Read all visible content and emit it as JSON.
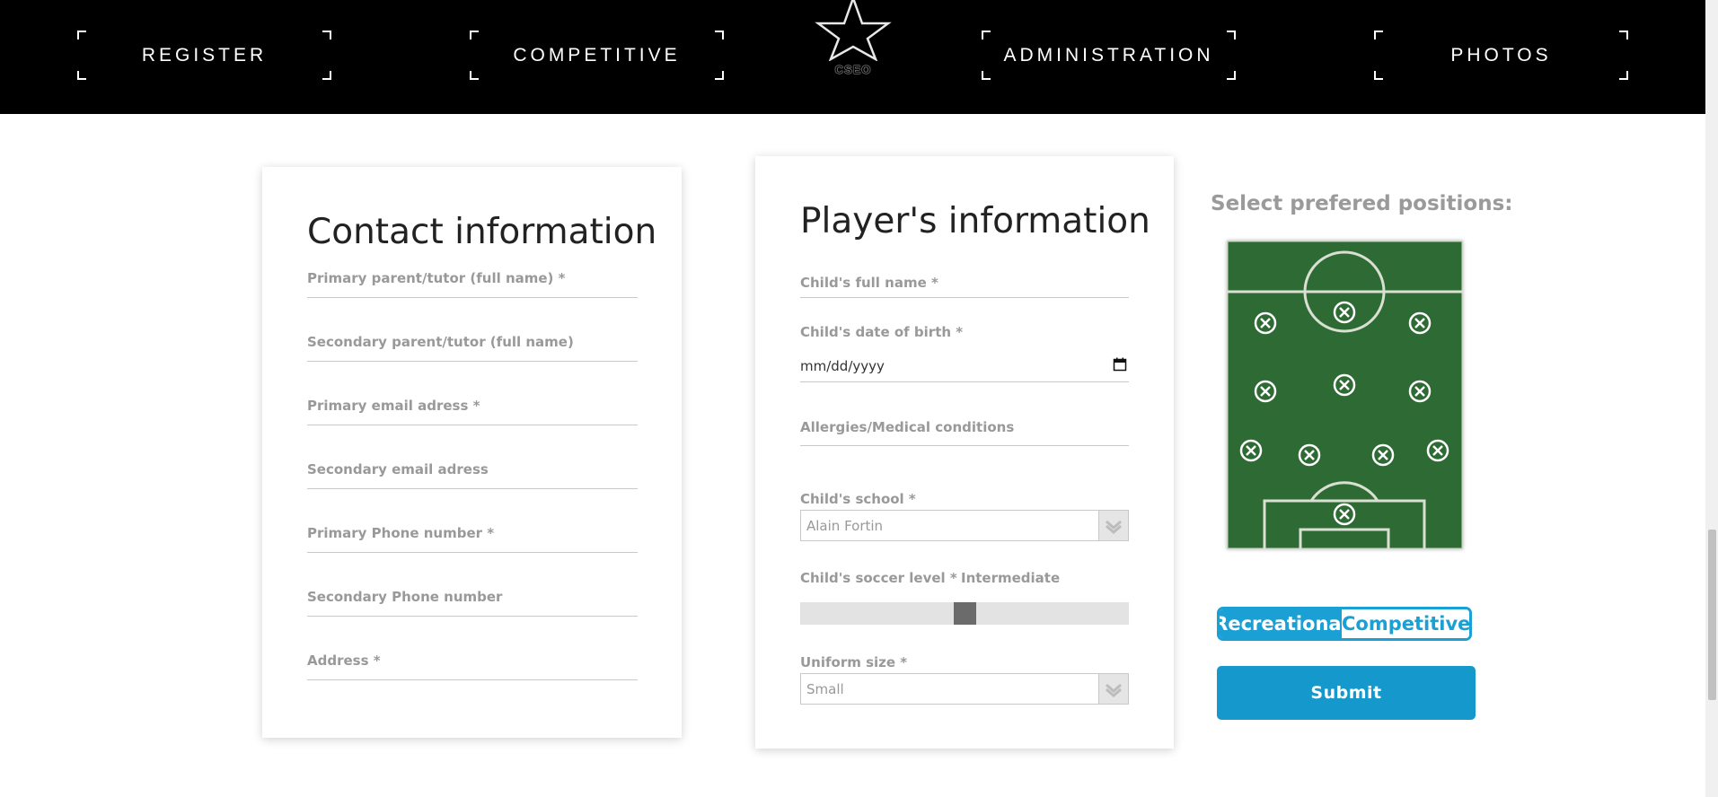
{
  "nav": {
    "items": [
      {
        "label": "REGISTER"
      },
      {
        "label": "COMPETITIVE"
      },
      {
        "label": "ADMINISTRATION"
      },
      {
        "label": "PHOTOS"
      }
    ],
    "logo_text": "CSEO",
    "logo_icon": "star-icon"
  },
  "contact": {
    "title": "Contact information",
    "fields": [
      {
        "label": "Primary parent/tutor (full name) *"
      },
      {
        "label": "Secondary parent/tutor (full name)"
      },
      {
        "label": "Primary email adress *"
      },
      {
        "label": "Secondary email adress"
      },
      {
        "label": "Primary Phone number *"
      },
      {
        "label": "Secondary Phone number"
      },
      {
        "label": "Address *"
      }
    ]
  },
  "player": {
    "title": "Player's information",
    "name_label": "Child's full name *",
    "dob_label": "Child's date of birth *",
    "dob_placeholder": "mm/dd/yyyy",
    "allergies_label": "Allergies/Medical conditions",
    "school_label": "Child's school *",
    "school_value": "Alain Fortin",
    "level_label": "Child's soccer level *",
    "level_value": "Intermediate",
    "level_fraction": 0.5,
    "uniform_label": "Uniform size *",
    "uniform_value": "Small"
  },
  "positions": {
    "title": "Select prefered positions:",
    "marker_icon": "circle-x-icon"
  },
  "toggle": {
    "option1": "Recreational",
    "option2": "Competitive",
    "selected": "Recreational"
  },
  "submit_label": "Submit",
  "colors": {
    "accent": "#1aa0d4",
    "nav_bg": "#000000",
    "pitch": "#2e6b34"
  }
}
